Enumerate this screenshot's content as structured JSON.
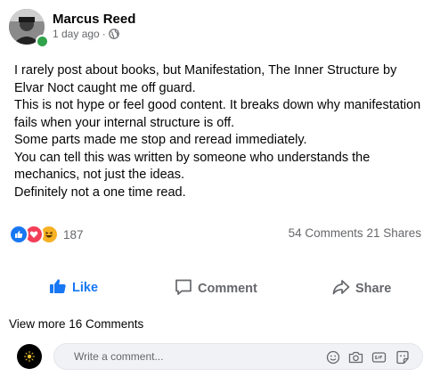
{
  "post": {
    "author": "Marcus Reed",
    "time": "1 day ago",
    "separator": "·",
    "body_lines": [
      "I rarely post about books, but Manifestation, The Inner Structure by Elvar Noct caught me off guard.",
      "This is not hype or feel good content. It breaks down why manifestation fails when your internal structure is off.",
      "Some parts made me stop and reread immediately.",
      "You can tell this was written by someone who understands the mechanics, not just the ideas.",
      "Definitely not a one time read."
    ],
    "reaction_count": "187",
    "comments_count": "54 Comments",
    "shares_count": "21 Shares"
  },
  "actions": {
    "like": "Like",
    "comment": "Comment",
    "share": "Share"
  },
  "comments": {
    "view_more": "View more 16 Comments",
    "placeholder": "Write a comment..."
  },
  "colors": {
    "brand_blue": "#1877f2",
    "online_green": "#31a24c",
    "muted_text": "#65676b",
    "input_bg": "#f0f2f5"
  },
  "icons": [
    "globe-icon",
    "like-reaction-icon",
    "love-reaction-icon",
    "haha-reaction-icon",
    "thumbs-up-icon",
    "comment-icon",
    "share-icon",
    "emoji-icon",
    "camera-icon",
    "gif-icon",
    "sticker-icon"
  ]
}
